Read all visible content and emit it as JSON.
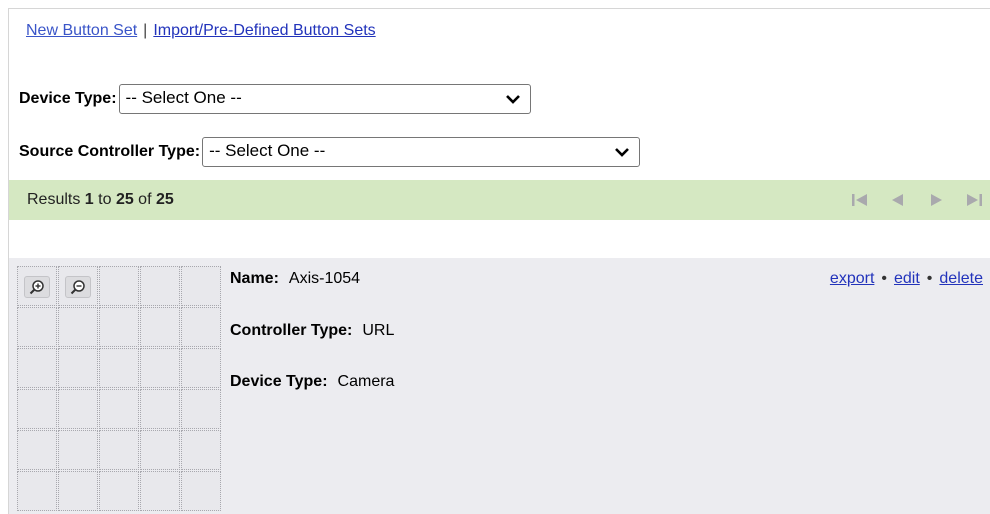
{
  "top_links": {
    "new_button_set": "New Button Set",
    "separator": "|",
    "import_sets": "Import/Pre-Defined Button Sets"
  },
  "filters": {
    "device_type_label": "Device Type:",
    "device_type_value": "-- Select One --",
    "source_controller_label": "Source Controller Type:",
    "source_controller_value": "-- Select One --"
  },
  "results": {
    "prefix": "Results ",
    "from": "1",
    "to_word": " to ",
    "to": "25",
    "of_word": " of ",
    "total": "25"
  },
  "pager_icons": [
    "first-page-icon",
    "prev-page-icon",
    "next-page-icon",
    "last-page-icon"
  ],
  "button_set": {
    "name_label": "Name:",
    "name": "Axis-1054",
    "controller_type_label": "Controller Type:",
    "controller_type": "URL",
    "device_type_label": "Device Type:",
    "device_type": "Camera",
    "actions": {
      "export": "export",
      "edit": "edit",
      "delete": "delete",
      "bullet": "•"
    },
    "grid": {
      "columns": 5,
      "rows": 6
    },
    "zoom_icons": [
      "zoom-in-icon",
      "zoom-out-icon"
    ]
  },
  "colors": {
    "link": "#2233bb",
    "results_bar_bg": "#d5e8c2",
    "card_bg": "#ececf0",
    "pager_icon": "#a9a9ad"
  }
}
